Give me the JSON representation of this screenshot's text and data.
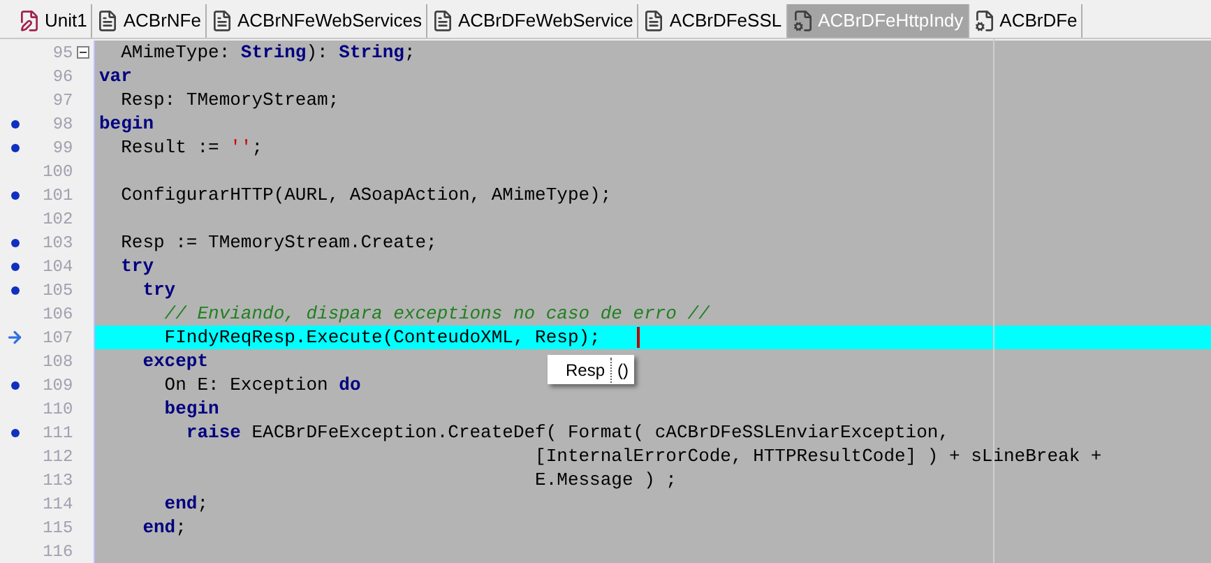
{
  "tabs": [
    {
      "label": "Unit1",
      "kind": "form",
      "selected": false
    },
    {
      "label": "ACBrNFe",
      "kind": "doc",
      "selected": false
    },
    {
      "label": "ACBrNFeWebServices",
      "kind": "doc",
      "selected": false
    },
    {
      "label": "ACBrDFeWebService",
      "kind": "doc",
      "selected": false
    },
    {
      "label": "ACBrDFeSSL",
      "kind": "doc",
      "selected": false
    },
    {
      "label": "ACBrDFeHttpIndy",
      "kind": "gear",
      "selected": true
    },
    {
      "label": "ACBrDFe",
      "kind": "gear",
      "selected": false
    }
  ],
  "editor": {
    "lines": [
      {
        "number": "95",
        "breakpoint": false,
        "execution_point": false,
        "fold": true,
        "cursor": false,
        "segments": [
          {
            "kind": "plain",
            "text": "  AMimeType: "
          },
          {
            "kind": "keyword",
            "text": "String"
          },
          {
            "kind": "plain",
            "text": "): "
          },
          {
            "kind": "keyword",
            "text": "String"
          },
          {
            "kind": "plain",
            "text": ";"
          }
        ]
      },
      {
        "number": "96",
        "breakpoint": false,
        "execution_point": false,
        "fold": false,
        "cursor": false,
        "segments": [
          {
            "kind": "keyword",
            "text": "var"
          }
        ]
      },
      {
        "number": "97",
        "breakpoint": false,
        "execution_point": false,
        "fold": false,
        "cursor": false,
        "segments": [
          {
            "kind": "plain",
            "text": "  Resp: TMemoryStream;"
          }
        ]
      },
      {
        "number": "98",
        "breakpoint": true,
        "execution_point": false,
        "fold": false,
        "cursor": false,
        "segments": [
          {
            "kind": "keyword",
            "text": "begin"
          }
        ]
      },
      {
        "number": "99",
        "breakpoint": true,
        "execution_point": false,
        "fold": false,
        "cursor": false,
        "segments": [
          {
            "kind": "plain",
            "text": "  Result := "
          },
          {
            "kind": "string",
            "text": "''"
          },
          {
            "kind": "plain",
            "text": ";"
          }
        ]
      },
      {
        "number": "100",
        "breakpoint": false,
        "execution_point": false,
        "fold": false,
        "cursor": false
      },
      {
        "number": "101",
        "breakpoint": true,
        "execution_point": false,
        "fold": false,
        "cursor": false,
        "segments": [
          {
            "kind": "plain",
            "text": "  ConfigurarHTTP(AURL, ASoapAction, AMimeType);"
          }
        ]
      },
      {
        "number": "102",
        "breakpoint": false,
        "execution_point": false,
        "fold": false,
        "cursor": false
      },
      {
        "number": "103",
        "breakpoint": true,
        "execution_point": false,
        "fold": false,
        "cursor": false,
        "segments": [
          {
            "kind": "plain",
            "text": "  Resp := TMemoryStream.Create;"
          }
        ]
      },
      {
        "number": "104",
        "breakpoint": true,
        "execution_point": false,
        "fold": false,
        "cursor": false,
        "segments": [
          {
            "kind": "keyword",
            "text": "  try"
          }
        ]
      },
      {
        "number": "105",
        "breakpoint": true,
        "execution_point": false,
        "fold": false,
        "cursor": false,
        "segments": [
          {
            "kind": "keyword",
            "text": "    try"
          }
        ]
      },
      {
        "number": "106",
        "breakpoint": false,
        "execution_point": false,
        "fold": false,
        "cursor": false,
        "segments": [
          {
            "kind": "comment",
            "text": "      // Enviando, dispara exceptions no caso de erro //"
          }
        ]
      },
      {
        "number": "107",
        "breakpoint": false,
        "execution_point": true,
        "fold": false,
        "cursor": true,
        "segments": [
          {
            "kind": "plain",
            "text": "      FIndyReqResp.Execute(ConteudoXML, Resp);"
          }
        ]
      },
      {
        "number": "108",
        "breakpoint": false,
        "execution_point": false,
        "fold": false,
        "cursor": false,
        "segments": [
          {
            "kind": "keyword",
            "text": "    except"
          }
        ]
      },
      {
        "number": "109",
        "breakpoint": true,
        "execution_point": false,
        "fold": false,
        "cursor": false,
        "segments": [
          {
            "kind": "plain",
            "text": "      On E: Exception "
          },
          {
            "kind": "keyword",
            "text": "do"
          }
        ]
      },
      {
        "number": "110",
        "breakpoint": false,
        "execution_point": false,
        "fold": false,
        "cursor": false,
        "segments": [
          {
            "kind": "keyword",
            "text": "      begin"
          }
        ]
      },
      {
        "number": "111",
        "breakpoint": true,
        "execution_point": false,
        "fold": false,
        "cursor": false,
        "segments": [
          {
            "kind": "keyword",
            "text": "        raise"
          },
          {
            "kind": "plain",
            "text": " EACBrDFeException.CreateDef( Format( cACBrDFeSSLEnviarException,"
          }
        ]
      },
      {
        "number": "112",
        "breakpoint": false,
        "execution_point": false,
        "fold": false,
        "cursor": false,
        "segments": [
          {
            "kind": "plain",
            "text": "                                        [InternalErrorCode, HTTPResultCode] ) + sLineBreak +"
          }
        ]
      },
      {
        "number": "113",
        "breakpoint": false,
        "execution_point": false,
        "fold": false,
        "cursor": false,
        "segments": [
          {
            "kind": "plain",
            "text": "                                        E.Message ) ;"
          }
        ]
      },
      {
        "number": "114",
        "breakpoint": false,
        "execution_point": false,
        "fold": false,
        "cursor": false,
        "segments": [
          {
            "kind": "keyword",
            "text": "      end"
          },
          {
            "kind": "plain",
            "text": ";"
          }
        ]
      },
      {
        "number": "115",
        "breakpoint": false,
        "execution_point": false,
        "fold": false,
        "cursor": false,
        "segments": [
          {
            "kind": "keyword",
            "text": "    end"
          },
          {
            "kind": "plain",
            "text": ";"
          }
        ]
      },
      {
        "number": "116",
        "breakpoint": false,
        "execution_point": false,
        "fold": false,
        "cursor": false
      }
    ]
  },
  "tooltip": {
    "name": "Resp",
    "value": "()"
  }
}
